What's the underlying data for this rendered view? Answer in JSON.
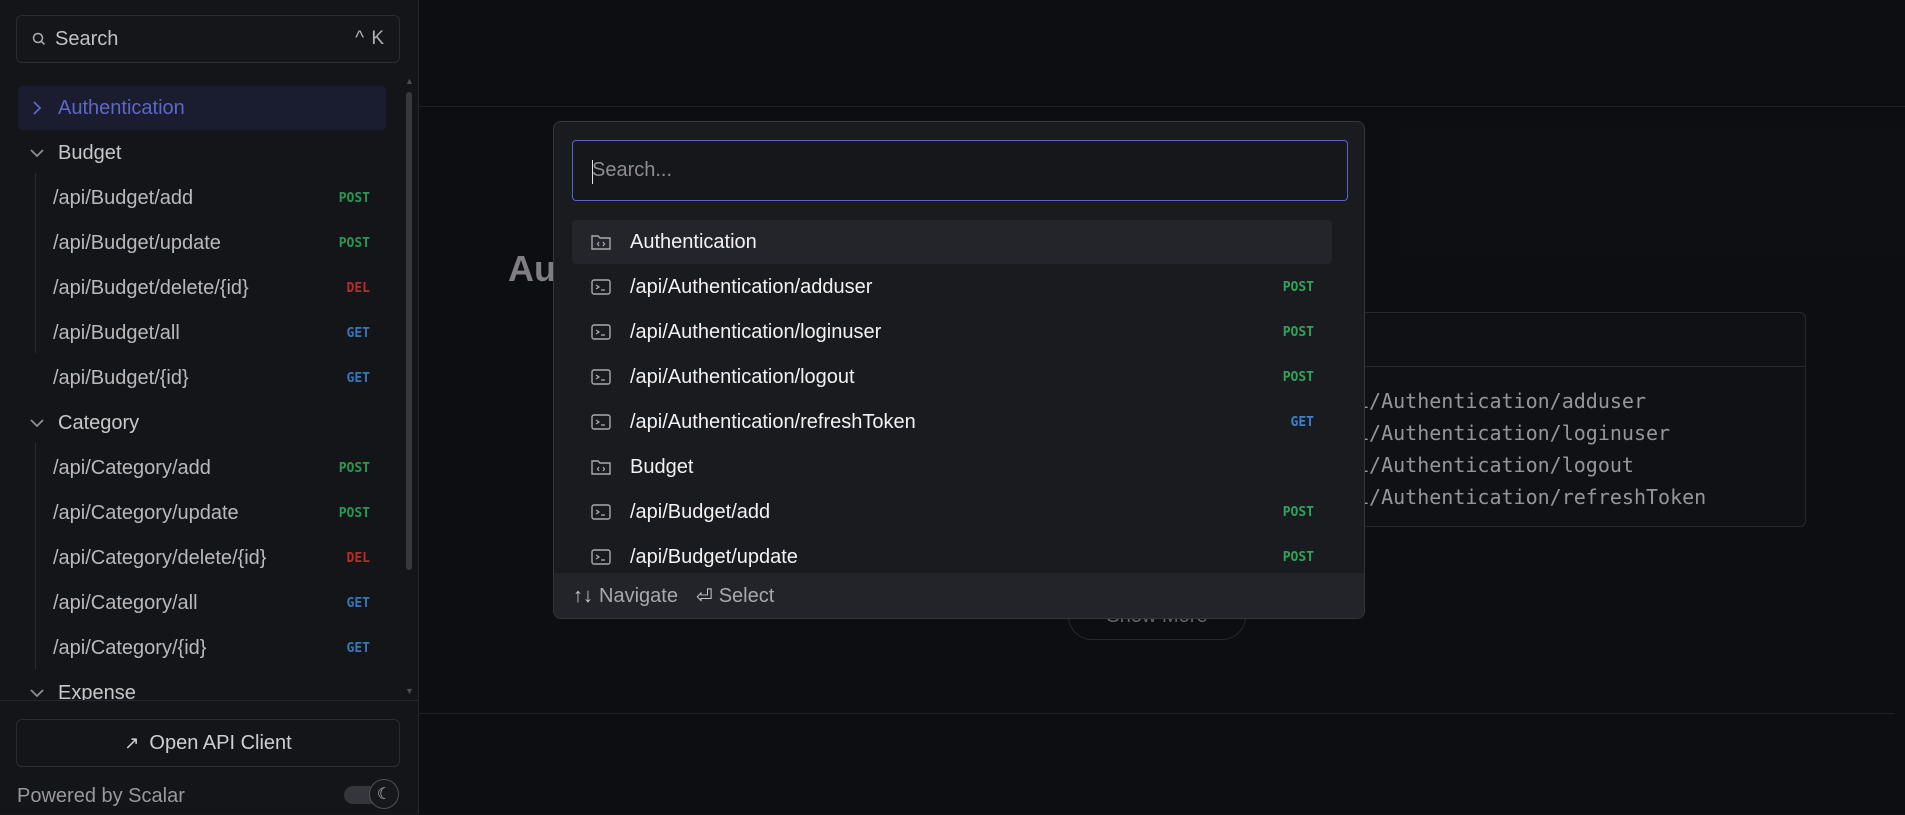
{
  "sidebar": {
    "search": {
      "placeholder": "Search",
      "shortcut": "^ K"
    },
    "items": [
      {
        "label": "Authentication",
        "type": "group",
        "expanded": false,
        "active": true
      },
      {
        "label": "Budget",
        "type": "group",
        "expanded": true
      },
      {
        "label": "/api/Budget/add",
        "type": "endpoint",
        "method": "POST"
      },
      {
        "label": "/api/Budget/update",
        "type": "endpoint",
        "method": "POST"
      },
      {
        "label": "/api/Budget/delete/{id}",
        "type": "endpoint",
        "method": "DEL"
      },
      {
        "label": "/api/Budget/all",
        "type": "endpoint",
        "method": "GET"
      },
      {
        "label": "/api/Budget/{id}",
        "type": "endpoint",
        "method": "GET"
      },
      {
        "label": "Category",
        "type": "group",
        "expanded": true
      },
      {
        "label": "/api/Category/add",
        "type": "endpoint",
        "method": "POST"
      },
      {
        "label": "/api/Category/update",
        "type": "endpoint",
        "method": "POST"
      },
      {
        "label": "/api/Category/delete/{id}",
        "type": "endpoint",
        "method": "DEL"
      },
      {
        "label": "/api/Category/all",
        "type": "endpoint",
        "method": "GET"
      },
      {
        "label": "/api/Category/{id}",
        "type": "endpoint",
        "method": "GET"
      },
      {
        "label": "Expense",
        "type": "group",
        "expanded": true
      }
    ],
    "footer": {
      "open_client_label": "Open API Client",
      "powered_by": "Powered by Scalar"
    }
  },
  "main": {
    "section_title_partial": "Au",
    "endpoint_lines": [
      "i/Authentication/adduser",
      "i/Authentication/loginuser",
      "i/Authentication/logout",
      "i/Authentication/refreshToken"
    ],
    "show_more_label": "Show More"
  },
  "palette": {
    "search": {
      "placeholder": "Search...",
      "value": ""
    },
    "results": [
      {
        "label": "Authentication",
        "kind": "folder",
        "selected": true
      },
      {
        "label": "/api/Authentication/adduser",
        "kind": "endpoint",
        "method": "POST"
      },
      {
        "label": "/api/Authentication/loginuser",
        "kind": "endpoint",
        "method": "POST"
      },
      {
        "label": "/api/Authentication/logout",
        "kind": "endpoint",
        "method": "POST"
      },
      {
        "label": "/api/Authentication/refreshToken",
        "kind": "endpoint",
        "method": "GET"
      },
      {
        "label": "Budget",
        "kind": "folder"
      },
      {
        "label": "/api/Budget/add",
        "kind": "endpoint",
        "method": "POST"
      },
      {
        "label": "/api/Budget/update",
        "kind": "endpoint",
        "method": "POST"
      }
    ],
    "footer": {
      "navigate_keys": "↑↓",
      "navigate_label": "Navigate",
      "select_key": "⏎",
      "select_label": "Select"
    }
  },
  "colors": {
    "accent": "#5b63c9",
    "post": "#2fa45a",
    "get": "#3b82c8",
    "del": "#c5322f"
  }
}
